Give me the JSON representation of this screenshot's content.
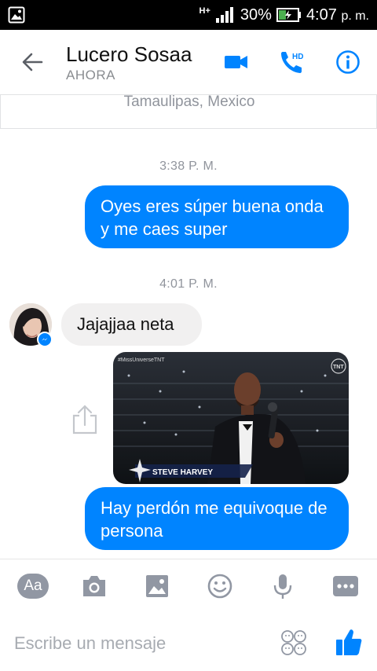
{
  "status_bar": {
    "network": "H+",
    "battery_percent": "30%",
    "time": "4:07",
    "time_suffix": "p. m."
  },
  "header": {
    "contact_name": "Lucero Sosaa",
    "contact_status": "AHORA",
    "hd_label": "HD"
  },
  "location_card": {
    "text": "Tamaulipas, Mexico"
  },
  "conversation": {
    "timestamp_1": "3:38 P. M.",
    "message_1": "Oyes eres súper buena onda y me caes super",
    "timestamp_2": "4:01 P. M.",
    "message_2": "Jajajjaa neta",
    "photo_caption": "STEVE HARVEY",
    "photo_watermark": "#MissUniverseTNT",
    "photo_channel_logo": "TNT",
    "message_3": "Hay perdón me equivoque de persona"
  },
  "composer": {
    "aa_label": "Aa",
    "placeholder": "Escribe un mensaje"
  },
  "colors": {
    "accent": "#0084ff",
    "incoming_bubble": "#f1f0f0",
    "muted": "#90949c",
    "tool_icons": "#9197a3"
  },
  "icons": [
    "gallery-icon",
    "signal-icon",
    "battery-icon",
    "back-arrow-icon",
    "video-call-icon",
    "hd-call-icon",
    "info-icon",
    "messenger-badge-icon",
    "share-icon",
    "camera-icon",
    "image-icon",
    "emoji-icon",
    "microphone-icon",
    "more-icon",
    "stickers-icon",
    "like-icon"
  ]
}
